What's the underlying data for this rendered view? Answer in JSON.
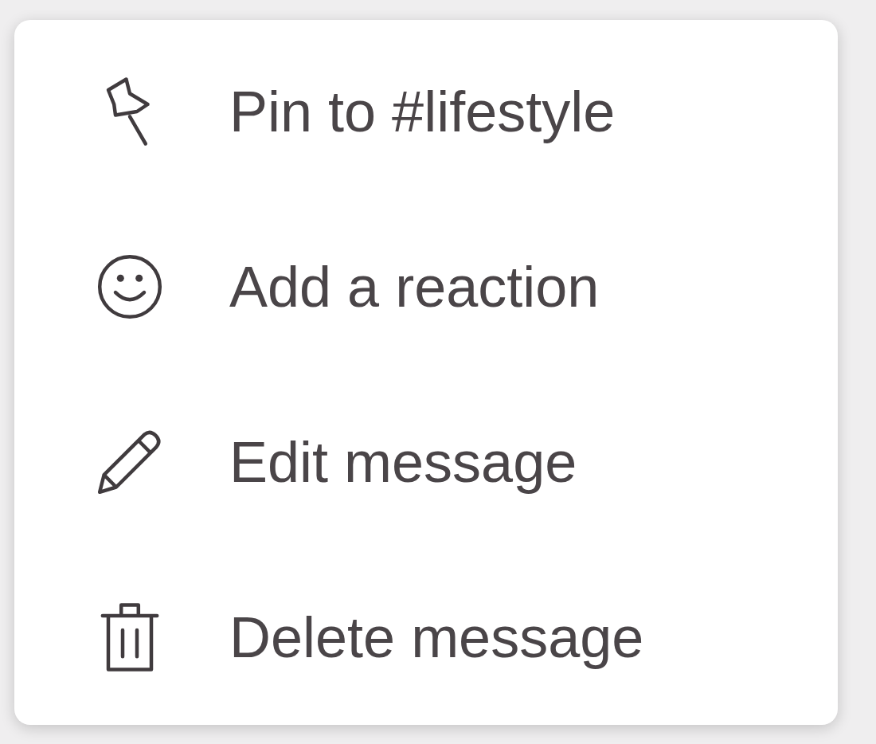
{
  "menu": {
    "items": [
      {
        "label": "Pin to #lifestyle"
      },
      {
        "label": "Add a reaction"
      },
      {
        "label": "Edit message"
      },
      {
        "label": "Delete message"
      }
    ]
  }
}
